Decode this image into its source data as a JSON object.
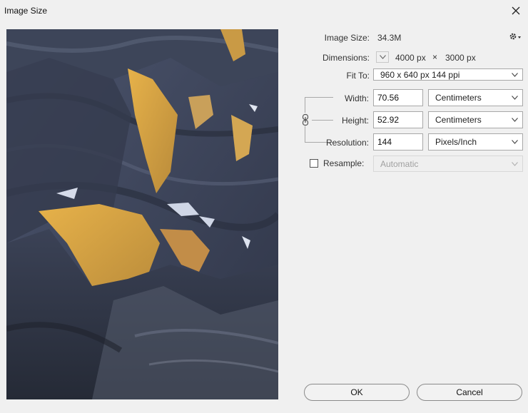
{
  "window": {
    "title": "Image Size"
  },
  "info": {
    "image_size_label": "Image Size:",
    "image_size_value": "34.3M",
    "dimensions_label": "Dimensions:",
    "dim_width": "4000 px",
    "dim_times": "×",
    "dim_height": "3000 px"
  },
  "fit_to": {
    "label": "Fit To:",
    "value": "960 x 640 px 144 ppi"
  },
  "width": {
    "label": "Width:",
    "value": "70.56",
    "unit": "Centimeters"
  },
  "height": {
    "label": "Height:",
    "value": "52.92",
    "unit": "Centimeters"
  },
  "resolution": {
    "label": "Resolution:",
    "value": "144",
    "unit": "Pixels/Inch"
  },
  "resample": {
    "label": "Resample:",
    "checked": false,
    "value": "Automatic"
  },
  "buttons": {
    "ok": "OK",
    "cancel": "Cancel"
  },
  "icons": {
    "close": "close-icon",
    "gear": "gear-icon",
    "chain": "chain-link-icon",
    "dim_toggle": "chevron-down-icon",
    "dropdown": "chevron-down-icon"
  }
}
